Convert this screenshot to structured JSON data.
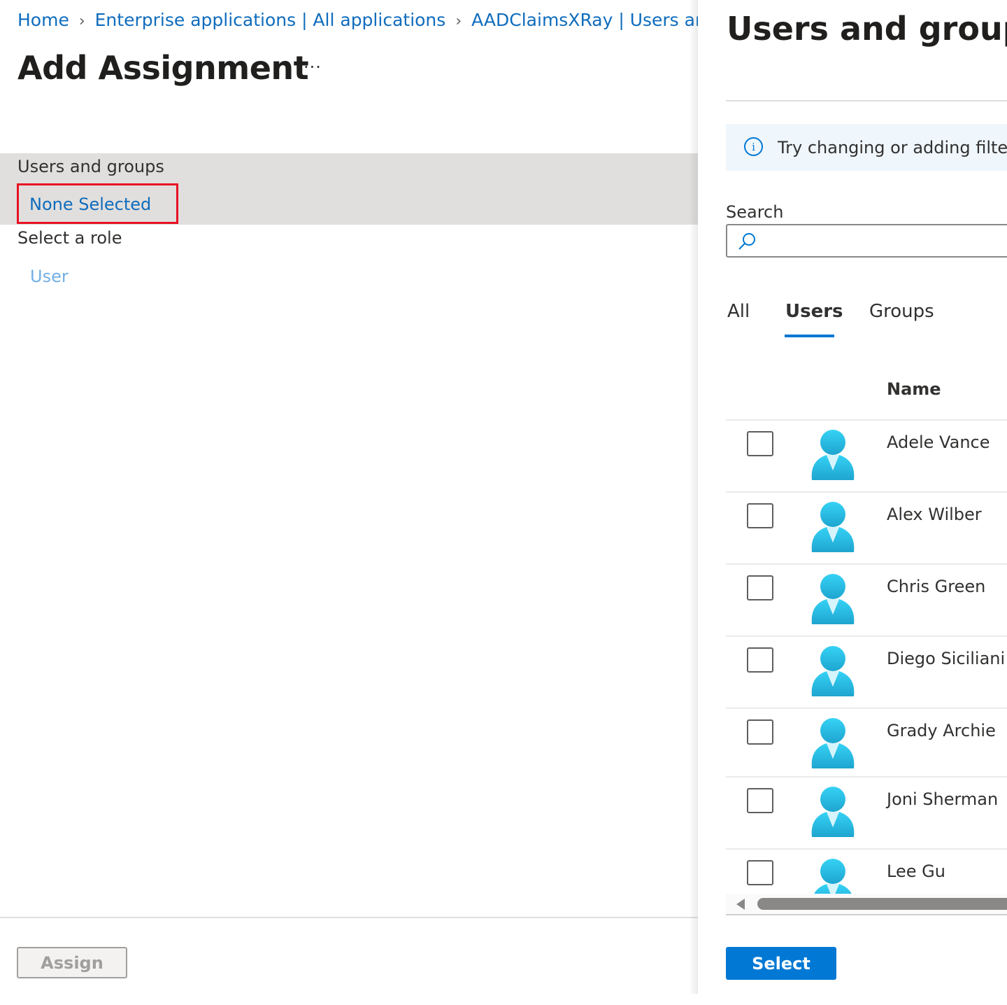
{
  "breadcrumb": [
    {
      "label": "Home"
    },
    {
      "label": "Enterprise applications | All applications"
    },
    {
      "label": "AADClaimsXRay | Users and groups"
    }
  ],
  "breadcrumb_separator": "›",
  "page": {
    "title": "Add Assignment",
    "more_label": "···"
  },
  "form": {
    "users_groups_label": "Users and groups",
    "users_groups_value": "None Selected",
    "role_label": "Select a role",
    "role_value": "User"
  },
  "footer": {
    "assign_label": "Assign"
  },
  "panel": {
    "title": "Users and groups",
    "info_icon": "i",
    "info_text": "Try changing or adding filters",
    "search_label": "Search",
    "search_value": "",
    "search_placeholder": "",
    "tabs": [
      {
        "label": "All",
        "active": false
      },
      {
        "label": "Users",
        "active": true
      },
      {
        "label": "Groups",
        "active": false
      }
    ],
    "column_name": "Name",
    "users": [
      {
        "name": "Adele Vance",
        "checked": false,
        "icon": "user-icon"
      },
      {
        "name": "Alex Wilber",
        "checked": false,
        "icon": "user-icon"
      },
      {
        "name": "Chris Green",
        "checked": false,
        "icon": "user-icon"
      },
      {
        "name": "Diego Siciliani",
        "checked": false,
        "icon": "user-icon"
      },
      {
        "name": "Grady Archie",
        "checked": false,
        "icon": "user-icon"
      },
      {
        "name": "Joni Sherman",
        "checked": false,
        "icon": "user-icon"
      },
      {
        "name": "Lee Gu",
        "checked": false,
        "icon": "user-icon"
      }
    ],
    "select_label": "Select"
  },
  "colors": {
    "accent": "#0078d4",
    "link": "#0f6cbd",
    "highlight_box": "#e81123",
    "avatar": "#32c5f0"
  }
}
